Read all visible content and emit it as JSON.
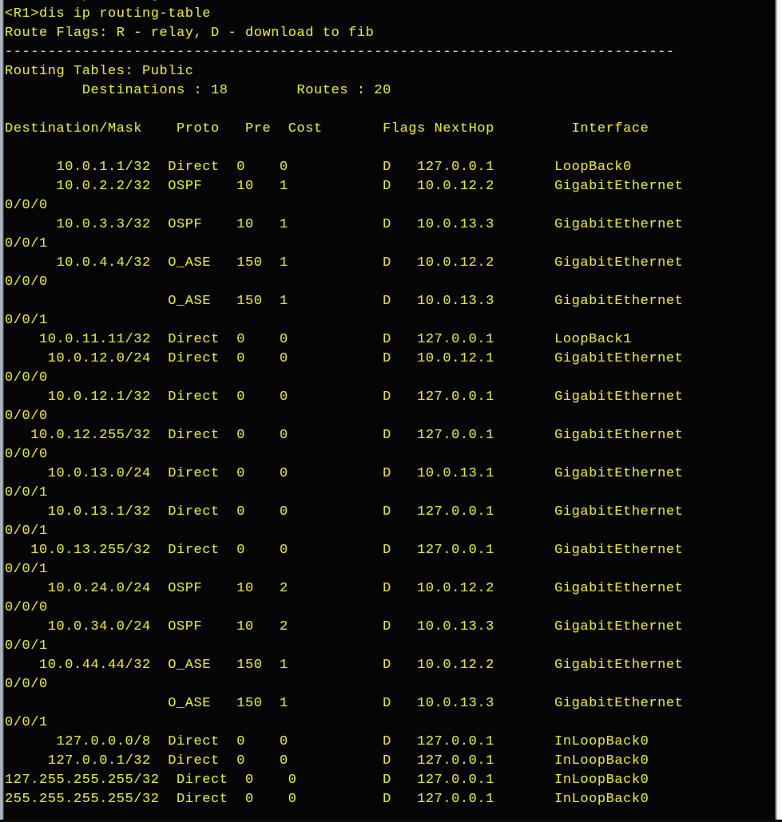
{
  "window": {
    "title": "Terminal - display ip routing-table",
    "background_color": "#050505",
    "text_color": "#e2e23e"
  },
  "terminal": {
    "prompt": "<R1>",
    "command": "dis ip routing-table",
    "prompt_line": "<R1>dis ip routing-table",
    "route_flags_line": "Route Flags: R - relay, D - download to fib",
    "separator": "------------------------------------------------------------------------------",
    "routing_tables_line": "Routing Tables: Public",
    "summary_line": "         Destinations : 18        Routes : 20",
    "destinations_label": "Destinations :",
    "destinations_count": "18",
    "routes_label": "Routes :",
    "routes_count": "20",
    "columns": [
      "Destination/Mask",
      "Proto",
      "Pre",
      "Cost",
      "Flags",
      "NextHop",
      "Interface"
    ],
    "header_line": "Destination/Mask    Proto   Pre  Cost       Flags NextHop         Interface",
    "rows": [
      {
        "dest": "10.0.1.1/32",
        "proto": "Direct",
        "pre": "0",
        "cost": "0",
        "flags": "D",
        "nexthop": "127.0.0.1",
        "interface": "LoopBack0",
        "wrap": ""
      },
      {
        "dest": "10.0.2.2/32",
        "proto": "OSPF",
        "pre": "10",
        "cost": "1",
        "flags": "D",
        "nexthop": "10.0.12.2",
        "interface": "GigabitEthernet",
        "wrap": "0/0/0"
      },
      {
        "dest": "10.0.3.3/32",
        "proto": "OSPF",
        "pre": "10",
        "cost": "1",
        "flags": "D",
        "nexthop": "10.0.13.3",
        "interface": "GigabitEthernet",
        "wrap": "0/0/1"
      },
      {
        "dest": "10.0.4.4/32",
        "proto": "O_ASE",
        "pre": "150",
        "cost": "1",
        "flags": "D",
        "nexthop": "10.0.12.2",
        "interface": "GigabitEthernet",
        "wrap": "0/0/0"
      },
      {
        "dest": "",
        "proto": "O_ASE",
        "pre": "150",
        "cost": "1",
        "flags": "D",
        "nexthop": "10.0.13.3",
        "interface": "GigabitEthernet",
        "wrap": "0/0/1"
      },
      {
        "dest": "10.0.11.11/32",
        "proto": "Direct",
        "pre": "0",
        "cost": "0",
        "flags": "D",
        "nexthop": "127.0.0.1",
        "interface": "LoopBack1",
        "wrap": ""
      },
      {
        "dest": "10.0.12.0/24",
        "proto": "Direct",
        "pre": "0",
        "cost": "0",
        "flags": "D",
        "nexthop": "10.0.12.1",
        "interface": "GigabitEthernet",
        "wrap": "0/0/0"
      },
      {
        "dest": "10.0.12.1/32",
        "proto": "Direct",
        "pre": "0",
        "cost": "0",
        "flags": "D",
        "nexthop": "127.0.0.1",
        "interface": "GigabitEthernet",
        "wrap": "0/0/0"
      },
      {
        "dest": "10.0.12.255/32",
        "proto": "Direct",
        "pre": "0",
        "cost": "0",
        "flags": "D",
        "nexthop": "127.0.0.1",
        "interface": "GigabitEthernet",
        "wrap": "0/0/0"
      },
      {
        "dest": "10.0.13.0/24",
        "proto": "Direct",
        "pre": "0",
        "cost": "0",
        "flags": "D",
        "nexthop": "10.0.13.1",
        "interface": "GigabitEthernet",
        "wrap": "0/0/1"
      },
      {
        "dest": "10.0.13.1/32",
        "proto": "Direct",
        "pre": "0",
        "cost": "0",
        "flags": "D",
        "nexthop": "127.0.0.1",
        "interface": "GigabitEthernet",
        "wrap": "0/0/1"
      },
      {
        "dest": "10.0.13.255/32",
        "proto": "Direct",
        "pre": "0",
        "cost": "0",
        "flags": "D",
        "nexthop": "127.0.0.1",
        "interface": "GigabitEthernet",
        "wrap": "0/0/1"
      },
      {
        "dest": "10.0.24.0/24",
        "proto": "OSPF",
        "pre": "10",
        "cost": "2",
        "flags": "D",
        "nexthop": "10.0.12.2",
        "interface": "GigabitEthernet",
        "wrap": "0/0/0"
      },
      {
        "dest": "10.0.34.0/24",
        "proto": "OSPF",
        "pre": "10",
        "cost": "2",
        "flags": "D",
        "nexthop": "10.0.13.3",
        "interface": "GigabitEthernet",
        "wrap": "0/0/1"
      },
      {
        "dest": "10.0.44.44/32",
        "proto": "O_ASE",
        "pre": "150",
        "cost": "1",
        "flags": "D",
        "nexthop": "10.0.12.2",
        "interface": "GigabitEthernet",
        "wrap": "0/0/0"
      },
      {
        "dest": "",
        "proto": "O_ASE",
        "pre": "150",
        "cost": "1",
        "flags": "D",
        "nexthop": "10.0.13.3",
        "interface": "GigabitEthernet",
        "wrap": "0/0/1"
      },
      {
        "dest": "127.0.0.0/8",
        "proto": "Direct",
        "pre": "0",
        "cost": "0",
        "flags": "D",
        "nexthop": "127.0.0.1",
        "interface": "InLoopBack0",
        "wrap": ""
      },
      {
        "dest": "127.0.0.1/32",
        "proto": "Direct",
        "pre": "0",
        "cost": "0",
        "flags": "D",
        "nexthop": "127.0.0.1",
        "interface": "InLoopBack0",
        "wrap": ""
      },
      {
        "dest": "127.255.255.255/32",
        "proto": "Direct",
        "pre": "0",
        "cost": "0",
        "flags": "D",
        "nexthop": "127.0.0.1",
        "interface": "InLoopBack0",
        "wrap": ""
      },
      {
        "dest": "255.255.255.255/32",
        "proto": "Direct",
        "pre": "0",
        "cost": "0",
        "flags": "D",
        "nexthop": "127.0.0.1",
        "interface": "InLoopBack0",
        "wrap": ""
      }
    ],
    "rendered_lines": [
      "<R1>dis ip routing-table",
      "Route Flags: R - relay, D - download to fib",
      "------------------------------------------------------------------------------",
      "Routing Tables: Public",
      "         Destinations : 18        Routes : 20",
      "",
      "Destination/Mask    Proto   Pre  Cost       Flags NextHop         Interface",
      "",
      "      10.0.1.1/32  Direct  0    0           D   127.0.0.1       LoopBack0",
      "      10.0.2.2/32  OSPF    10   1           D   10.0.12.2       GigabitEthernet",
      "0/0/0",
      "      10.0.3.3/32  OSPF    10   1           D   10.0.13.3       GigabitEthernet",
      "0/0/1",
      "      10.0.4.4/32  O_ASE   150  1           D   10.0.12.2       GigabitEthernet",
      "0/0/0",
      "                   O_ASE   150  1           D   10.0.13.3       GigabitEthernet",
      "0/0/1",
      "    10.0.11.11/32  Direct  0    0           D   127.0.0.1       LoopBack1",
      "     10.0.12.0/24  Direct  0    0           D   10.0.12.1       GigabitEthernet",
      "0/0/0",
      "     10.0.12.1/32  Direct  0    0           D   127.0.0.1       GigabitEthernet",
      "0/0/0",
      "   10.0.12.255/32  Direct  0    0           D   127.0.0.1       GigabitEthernet",
      "0/0/0",
      "     10.0.13.0/24  Direct  0    0           D   10.0.13.1       GigabitEthernet",
      "0/0/1",
      "     10.0.13.1/32  Direct  0    0           D   127.0.0.1       GigabitEthernet",
      "0/0/1",
      "   10.0.13.255/32  Direct  0    0           D   127.0.0.1       GigabitEthernet",
      "0/0/1",
      "     10.0.24.0/24  OSPF    10   2           D   10.0.12.2       GigabitEthernet",
      "0/0/0",
      "     10.0.34.0/24  OSPF    10   2           D   10.0.13.3       GigabitEthernet",
      "0/0/1",
      "    10.0.44.44/32  O_ASE   150  1           D   10.0.12.2       GigabitEthernet",
      "0/0/0",
      "                   O_ASE   150  1           D   10.0.13.3       GigabitEthernet",
      "0/0/1",
      "      127.0.0.0/8  Direct  0    0           D   127.0.0.1       InLoopBack0",
      "     127.0.0.1/32  Direct  0    0           D   127.0.0.1       InLoopBack0",
      "127.255.255.255/32  Direct  0    0          D   127.0.0.1       InLoopBack0",
      "255.255.255.255/32  Direct  0    0          D   127.0.0.1       InLoopBack0"
    ]
  }
}
